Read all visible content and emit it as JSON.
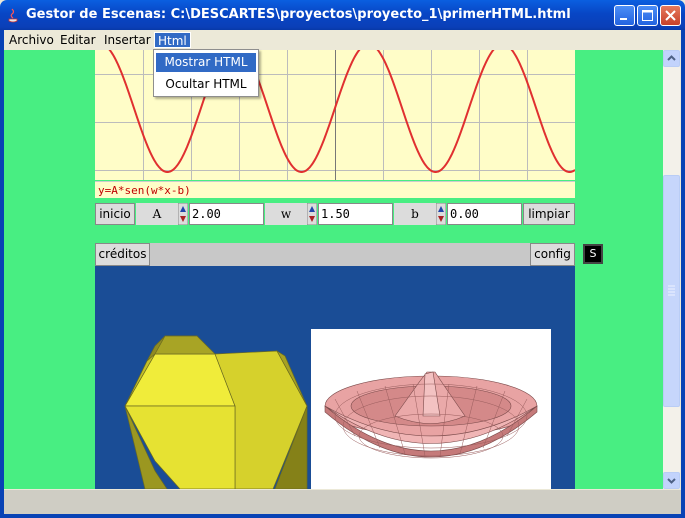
{
  "window": {
    "title": "Gestor de Escenas: C:\\DESCARTES\\proyectos\\proyecto_1\\primerHTML.html"
  },
  "menubar": {
    "items": [
      {
        "label": "Archivo"
      },
      {
        "label": "Editar"
      },
      {
        "label": "Insertar"
      },
      {
        "label": "Html"
      }
    ]
  },
  "html_menu": {
    "items": [
      {
        "label": "Mostrar HTML",
        "highlighted": true
      },
      {
        "label": "Ocultar HTML",
        "highlighted": false
      }
    ]
  },
  "applet1": {
    "formula": "y=A*sen(w*x-b)",
    "init_button": "inicio",
    "clear_button": "limpiar",
    "params": [
      {
        "name": "A",
        "value": "2.00"
      },
      {
        "name": "w",
        "value": "1.50"
      },
      {
        "name": "b",
        "value": "0.00"
      }
    ]
  },
  "applet2": {
    "credits_button": "créditos",
    "config_button": "config",
    "s_button": "S"
  },
  "colors": {
    "background": "#48ee82",
    "plot_background": "#fffdc8",
    "curve": "#e03030",
    "scene_background": "#1a4d96",
    "menu_highlight": "#316ac5"
  }
}
